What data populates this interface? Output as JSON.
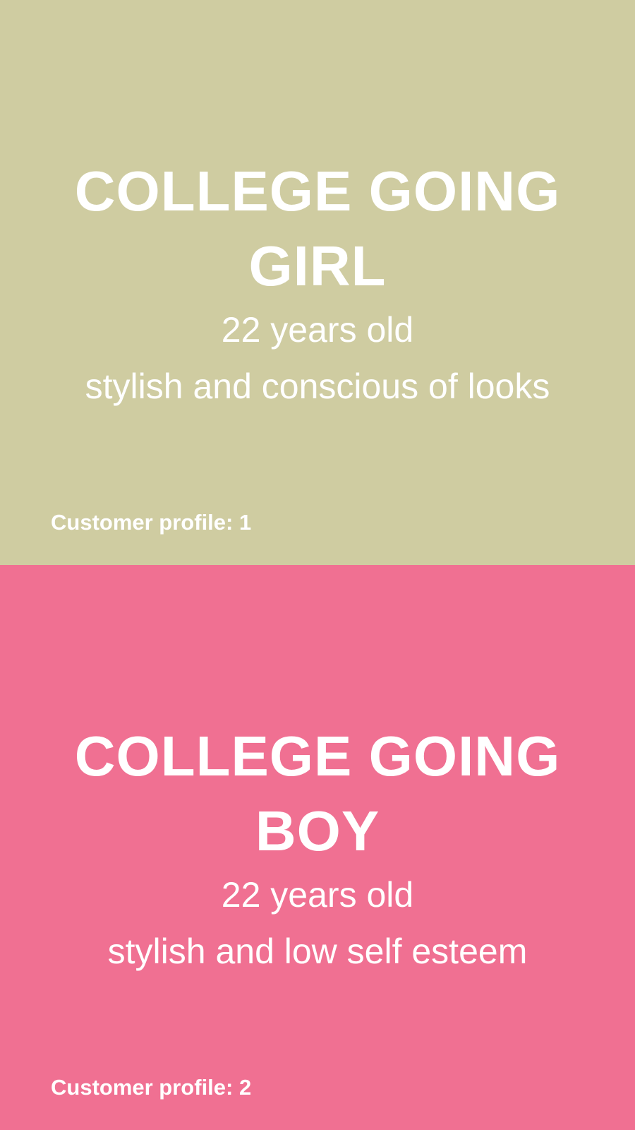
{
  "colors": {
    "panel_1_background": "#cfcca1",
    "panel_2_background": "#f07092",
    "text": "#ffffff"
  },
  "profiles": [
    {
      "title_line_1": "COLLEGE GOING",
      "title_line_2": "GIRL",
      "age": "22 years old",
      "description": "stylish and conscious of looks",
      "label": "Customer profile: 1"
    },
    {
      "title_line_1": "COLLEGE GOING",
      "title_line_2": "BOY",
      "age": "22 years old",
      "description": "stylish and low self esteem",
      "label": "Customer profile: 2"
    }
  ]
}
